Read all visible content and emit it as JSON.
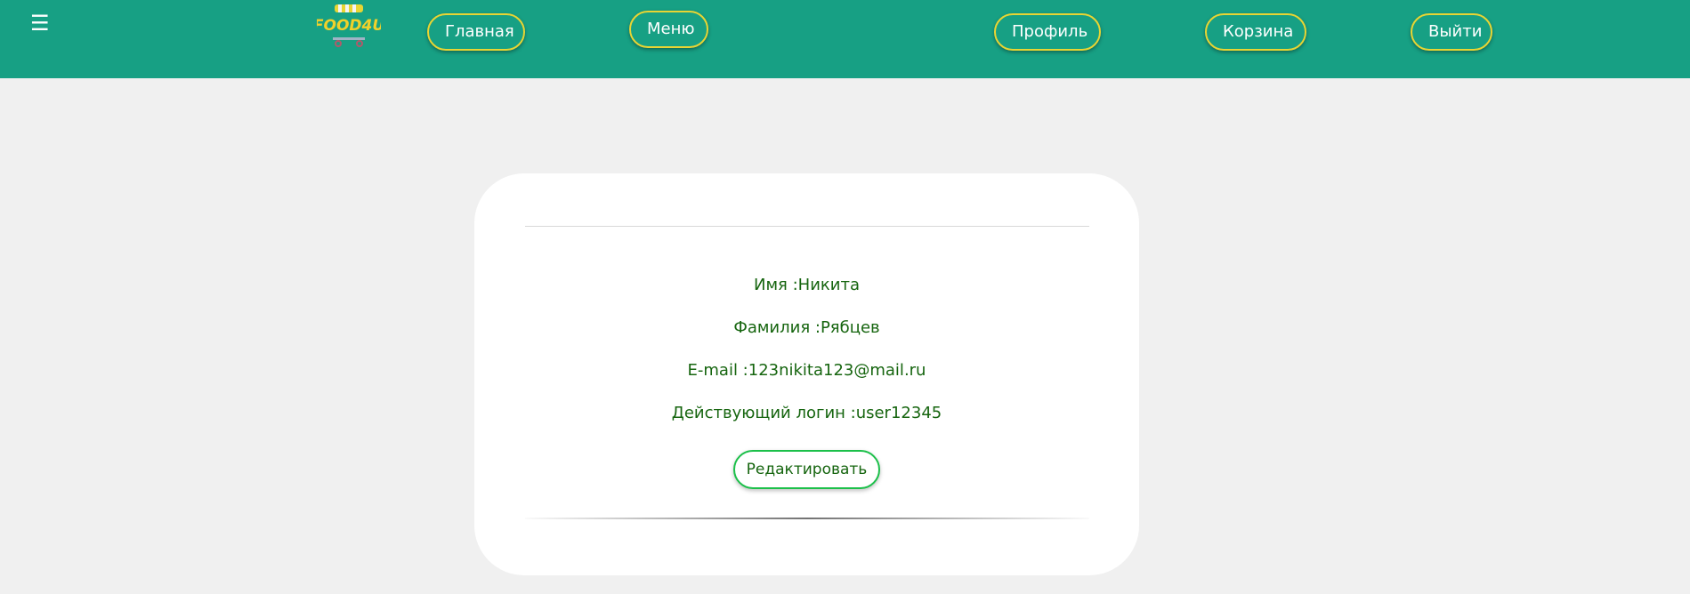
{
  "colors": {
    "navbar_bg": "#17a084",
    "nav_button_border": "#e8d533",
    "page_bg": "#f0f0f0",
    "card_bg": "#ffffff",
    "text_green": "#16650f",
    "edit_button_border": "#1cc04a"
  },
  "navbar": {
    "menu_icon": "hamburger-icon",
    "logo_text": "FOOD4U",
    "logo_icon": "food-cart-icon",
    "home_label": "Главная",
    "menu_label": "Меню",
    "profile_label": "Профиль",
    "cart_label": "Корзина",
    "logout_label": "Выйти"
  },
  "profile": {
    "name_line": "Имя :Никита",
    "surname_line": "Фамилия :Рябцев",
    "email_line": "E-mail :123nikita123@mail.ru",
    "login_line": "Действующий логин :user12345",
    "edit_label": "Редактировать"
  }
}
